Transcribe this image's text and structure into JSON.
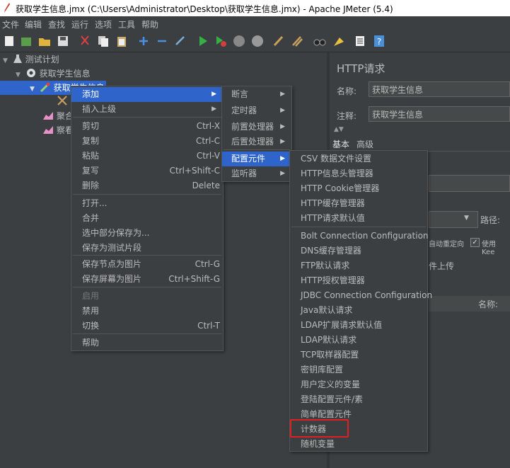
{
  "window": {
    "title": "获取学生信息.jmx (C:\\Users\\Administrator\\Desktop\\获取学生信息.jmx) - Apache JMeter (5.4)"
  },
  "menubar": [
    "文件",
    "编辑",
    "查找",
    "运行",
    "选项",
    "工具",
    "帮助"
  ],
  "tree": {
    "root": "测试计划",
    "thread_group": "获取学生信息",
    "selected": "获取学生信息",
    "children": [
      "聚合报告",
      "察看结果树"
    ]
  },
  "panel": {
    "title": "HTTP请求",
    "name_label": "名称:",
    "name_value": "获取学生信息",
    "comment_label": "注释:",
    "comment_value": "获取学生信息",
    "tabs": [
      "基本",
      "高级"
    ],
    "path_label": "路径:",
    "redirect_label": "自动重定向",
    "keepalive_label": "使用 Kee",
    "upload_label": "件上传",
    "params_name_header": "名称:"
  },
  "context_menu": {
    "items": [
      {
        "label": "添加",
        "arrow": true,
        "highlighted": true
      },
      {
        "label": "插入上级",
        "arrow": true
      },
      {
        "label": "剪切",
        "shortcut": "Ctrl-X"
      },
      {
        "label": "复制",
        "shortcut": "Ctrl-C"
      },
      {
        "label": "粘贴",
        "shortcut": "Ctrl-V"
      },
      {
        "label": "复写",
        "shortcut": "Ctrl+Shift-C"
      },
      {
        "label": "删除",
        "shortcut": "Delete"
      },
      {
        "label": "打开..."
      },
      {
        "label": "合并"
      },
      {
        "label": "选中部分保存为..."
      },
      {
        "label": "保存为测试片段"
      },
      {
        "label": "保存节点为图片",
        "shortcut": "Ctrl-G"
      },
      {
        "label": "保存屏幕为图片",
        "shortcut": "Ctrl+Shift-G"
      },
      {
        "label": "启用",
        "disabled": true
      },
      {
        "label": "禁用"
      },
      {
        "label": "切换",
        "shortcut": "Ctrl-T"
      },
      {
        "label": "帮助"
      }
    ]
  },
  "add_submenu": [
    "断言",
    "定时器",
    "前置处理器",
    "后置处理器",
    "配置元件",
    "监听器"
  ],
  "config_submenu": [
    "CSV 数据文件设置",
    "HTTP信息头管理器",
    "HTTP Cookie管理器",
    "HTTP缓存管理器",
    "HTTP请求默认值",
    "Bolt Connection Configuration",
    "DNS缓存管理器",
    "FTP默认请求",
    "HTTP授权管理器",
    "JDBC Connection Configuration",
    "Java默认请求",
    "LDAP扩展请求默认值",
    "LDAP默认请求",
    "TCP取样器配置",
    "密钥库配置",
    "用户定义的变量",
    "登陆配置元件/素",
    "简单配置元件",
    "计数器",
    "随机变量"
  ],
  "colors": {
    "highlight": "#2f65ca",
    "red_box": "#e02020",
    "bg": "#3c3f41"
  }
}
